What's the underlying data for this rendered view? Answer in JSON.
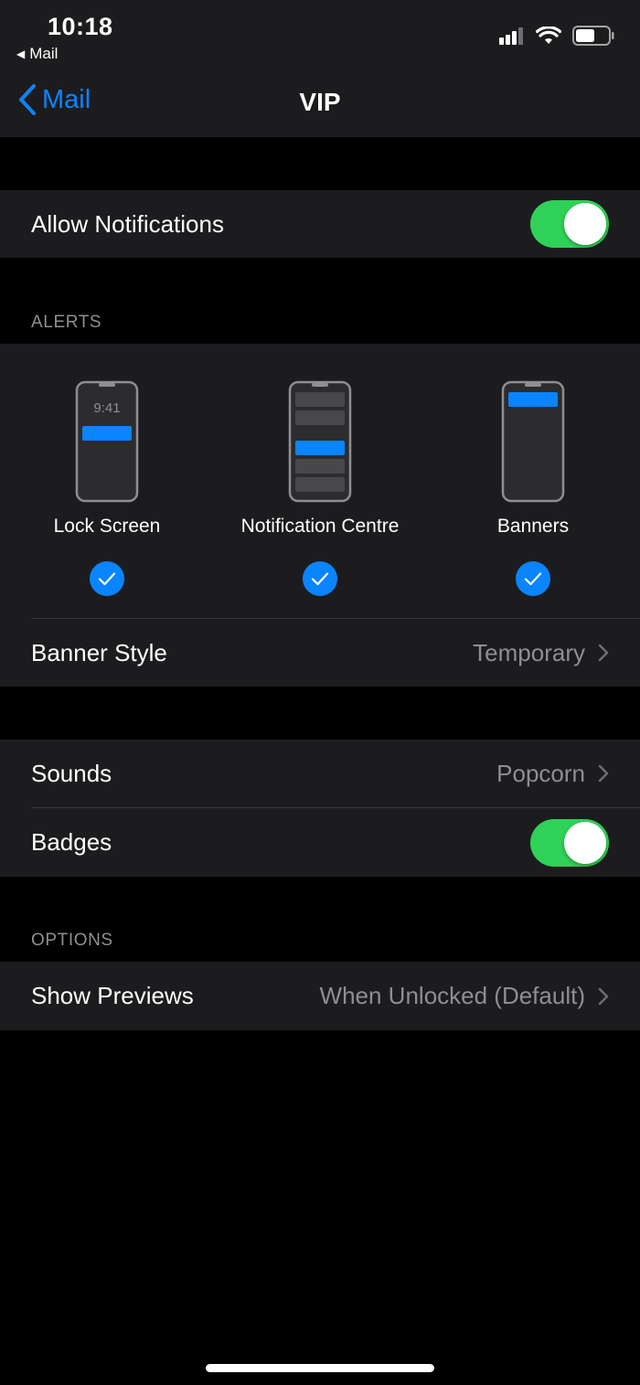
{
  "status_bar": {
    "time": "10:18",
    "back_app": "Mail",
    "signal_icon": "signal-bars-icon",
    "wifi_icon": "wifi-icon",
    "battery_icon": "battery-icon"
  },
  "nav": {
    "back_label": "Mail",
    "title": "VIP"
  },
  "allow_notifications": {
    "label": "Allow Notifications",
    "enabled": true
  },
  "alerts": {
    "header": "ALERTS",
    "options": [
      {
        "label": "Lock Screen",
        "preview_time": "9:41",
        "selected": true
      },
      {
        "label": "Notification Centre",
        "selected": true
      },
      {
        "label": "Banners",
        "selected": true
      }
    ],
    "banner_style": {
      "label": "Banner Style",
      "value": "Temporary"
    }
  },
  "sounds": {
    "label": "Sounds",
    "value": "Popcorn"
  },
  "badges": {
    "label": "Badges",
    "enabled": true
  },
  "options": {
    "header": "OPTIONS",
    "show_previews": {
      "label": "Show Previews",
      "value": "When Unlocked (Default)"
    }
  },
  "colors": {
    "accent": "#0a84ff",
    "toggle_on": "#30d158",
    "cell_bg": "#1c1c1e",
    "secondary_text": "#8e8e93"
  }
}
